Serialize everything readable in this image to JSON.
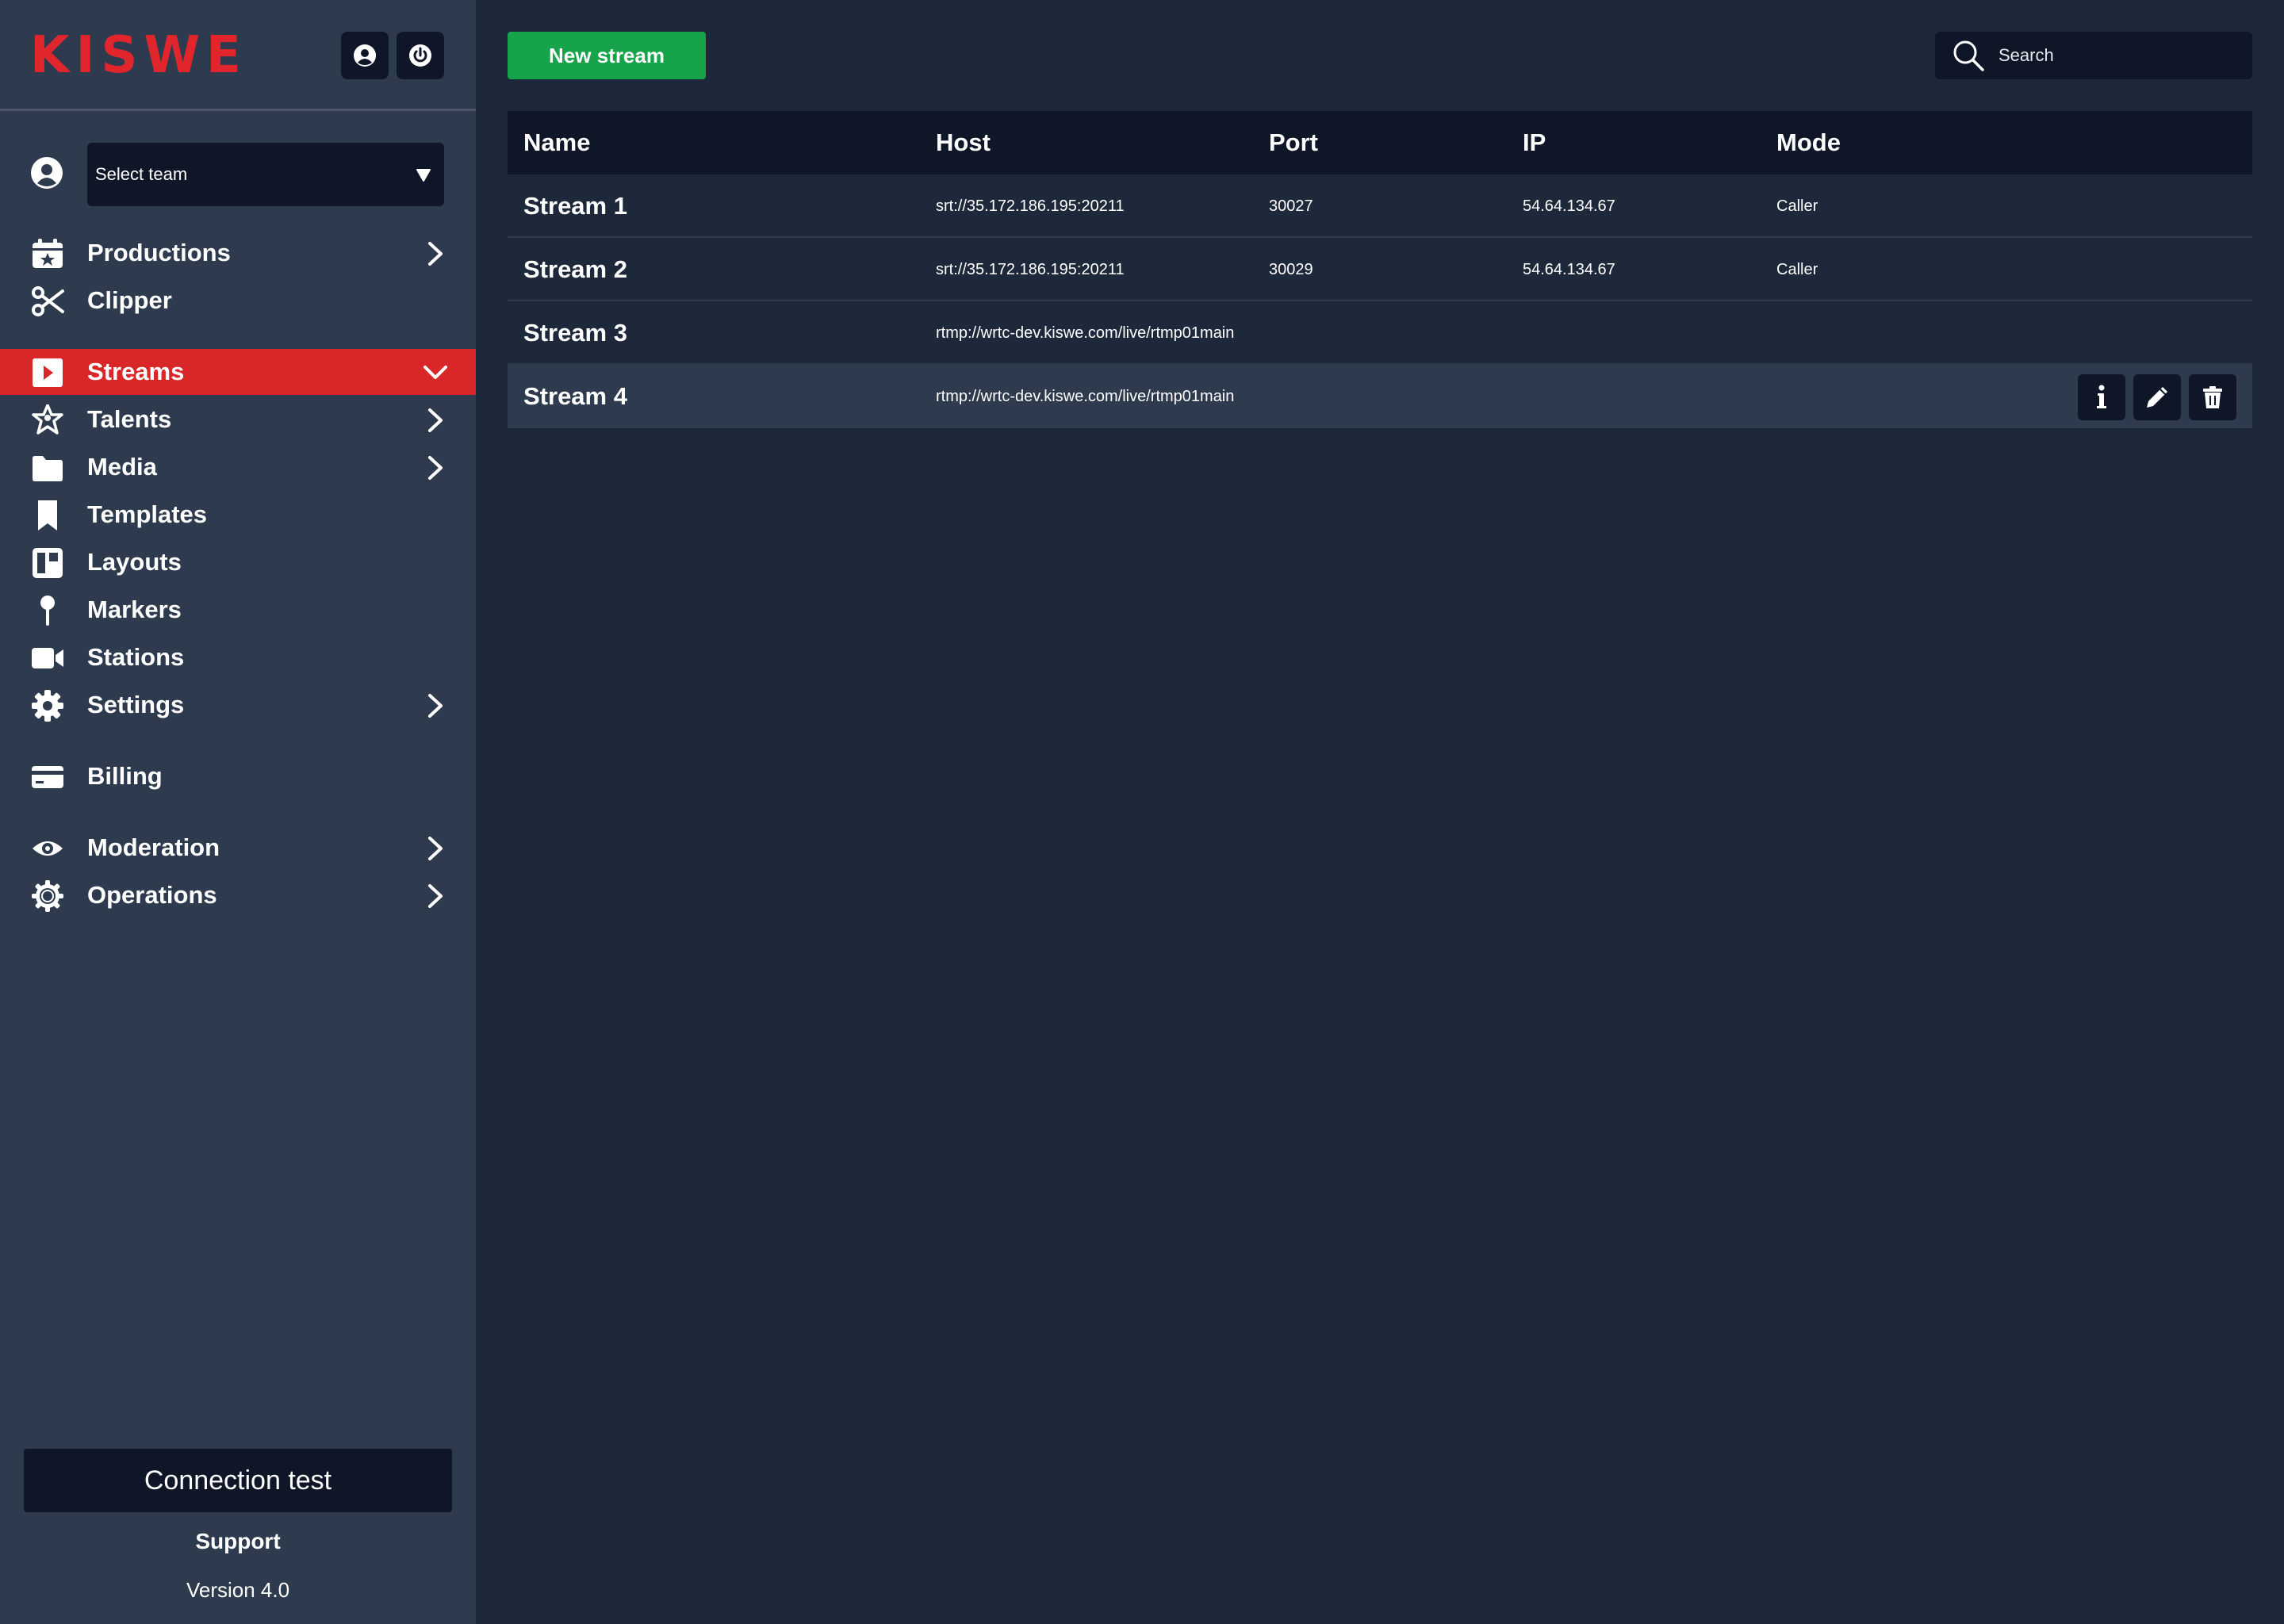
{
  "brand": {
    "logo_text": "KISWE",
    "accent": "#d92629"
  },
  "header": {
    "profile_icon": "user-circle-icon",
    "power_icon": "power-icon"
  },
  "team_select": {
    "value": "Select team"
  },
  "nav": {
    "productions": "Productions",
    "clipper": "Clipper",
    "streams": "Streams",
    "talents": "Talents",
    "media": "Media",
    "templates": "Templates",
    "layouts": "Layouts",
    "markers": "Markers",
    "stations": "Stations",
    "settings": "Settings",
    "billing": "Billing",
    "moderation": "Moderation",
    "operations": "Operations"
  },
  "footer": {
    "connection_test": "Connection test",
    "support": "Support",
    "version": "Version 4.0"
  },
  "toolbar": {
    "new_stream": "New stream",
    "search_placeholder": "Search"
  },
  "table": {
    "headers": {
      "name": "Name",
      "host": "Host",
      "port": "Port",
      "ip": "IP",
      "mode": "Mode"
    },
    "rows": [
      {
        "name": "Stream 1",
        "host": "srt://35.172.186.195:20211",
        "port": "30027",
        "ip": "54.64.134.67",
        "mode": "Caller"
      },
      {
        "name": "Stream 2",
        "host": "srt://35.172.186.195:20211",
        "port": "30029",
        "ip": "54.64.134.67",
        "mode": "Caller"
      },
      {
        "name": "Stream 3",
        "host": "rtmp://wrtc-dev.kiswe.com/live/rtmp01main",
        "port": "",
        "ip": "",
        "mode": ""
      },
      {
        "name": "Stream 4",
        "host": "rtmp://wrtc-dev.kiswe.com/live/rtmp01main",
        "port": "",
        "ip": "",
        "mode": ""
      }
    ],
    "row_actions": [
      "info-icon",
      "pencil-icon",
      "trash-icon"
    ]
  }
}
